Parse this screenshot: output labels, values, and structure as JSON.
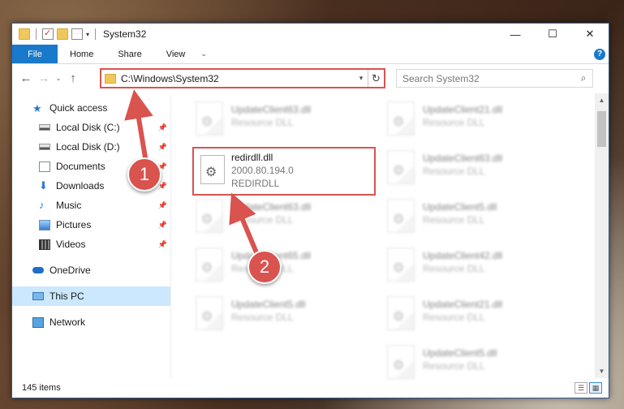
{
  "window": {
    "title": "System32",
    "controls": {
      "minimize": "—",
      "maximize": "☐",
      "close": "✕"
    }
  },
  "ribbon": {
    "tabs": [
      {
        "label": "File"
      },
      {
        "label": "Home"
      },
      {
        "label": "Share"
      },
      {
        "label": "View"
      }
    ],
    "help": "?"
  },
  "nav": {
    "back": "←",
    "forward": "→",
    "recent": "⌄",
    "up": "↑"
  },
  "address": {
    "path": "C:\\Windows\\System32",
    "refresh": "↻"
  },
  "search": {
    "placeholder": "Search System32",
    "icon": "⌕"
  },
  "sidebar": {
    "items": [
      {
        "label": "Quick access",
        "icon": "star-icon"
      },
      {
        "label": "Local Disk (C:)",
        "icon": "drive-icon",
        "pinned": true
      },
      {
        "label": "Local Disk (D:)",
        "icon": "drive-icon",
        "pinned": true
      },
      {
        "label": "Documents",
        "icon": "documents-icon",
        "pinned": true
      },
      {
        "label": "Downloads",
        "icon": "download-icon",
        "pinned": true
      },
      {
        "label": "Music",
        "icon": "music-icon",
        "pinned": true
      },
      {
        "label": "Pictures",
        "icon": "pictures-icon",
        "pinned": true
      },
      {
        "label": "Videos",
        "icon": "videos-icon",
        "pinned": true
      },
      {
        "label": "OneDrive",
        "icon": "cloud-icon"
      },
      {
        "label": "This PC",
        "icon": "computer-icon",
        "selected": true
      },
      {
        "label": "Network",
        "icon": "network-icon"
      }
    ]
  },
  "files": {
    "highlighted": {
      "name": "redirdll.dll",
      "version": "2000.80.194.0",
      "description": "REDIRDLL"
    },
    "left_column": [
      {
        "name": "UpdateClient63.dll",
        "type": "Resource DLL"
      },
      {
        "name": "UpdateClient63.dll",
        "type": "Resource DLL"
      },
      {
        "name": "UpdateClient65.dll",
        "type": "Resource DLL"
      },
      {
        "name": "UpdateClient5.dll",
        "type": "Resource DLL"
      }
    ],
    "right_column": [
      {
        "name": "UpdateClient21.dll",
        "type": "Resource DLL"
      },
      {
        "name": "UpdateClient63.dll",
        "type": "Resource DLL"
      },
      {
        "name": "UpdateClient5.dll",
        "type": "Resource DLL"
      },
      {
        "name": "UpdateClient42.dll",
        "type": "Resource DLL"
      },
      {
        "name": "UpdateClient21.dll",
        "type": "Resource DLL"
      },
      {
        "name": "UpdateClient5.dll",
        "type": "Resource DLL"
      }
    ]
  },
  "status": {
    "item_count": "145 items"
  },
  "callouts": {
    "one": "1",
    "two": "2"
  },
  "colors": {
    "accent": "#1979ca",
    "callout": "#d9534f",
    "selection": "#cce8ff"
  }
}
